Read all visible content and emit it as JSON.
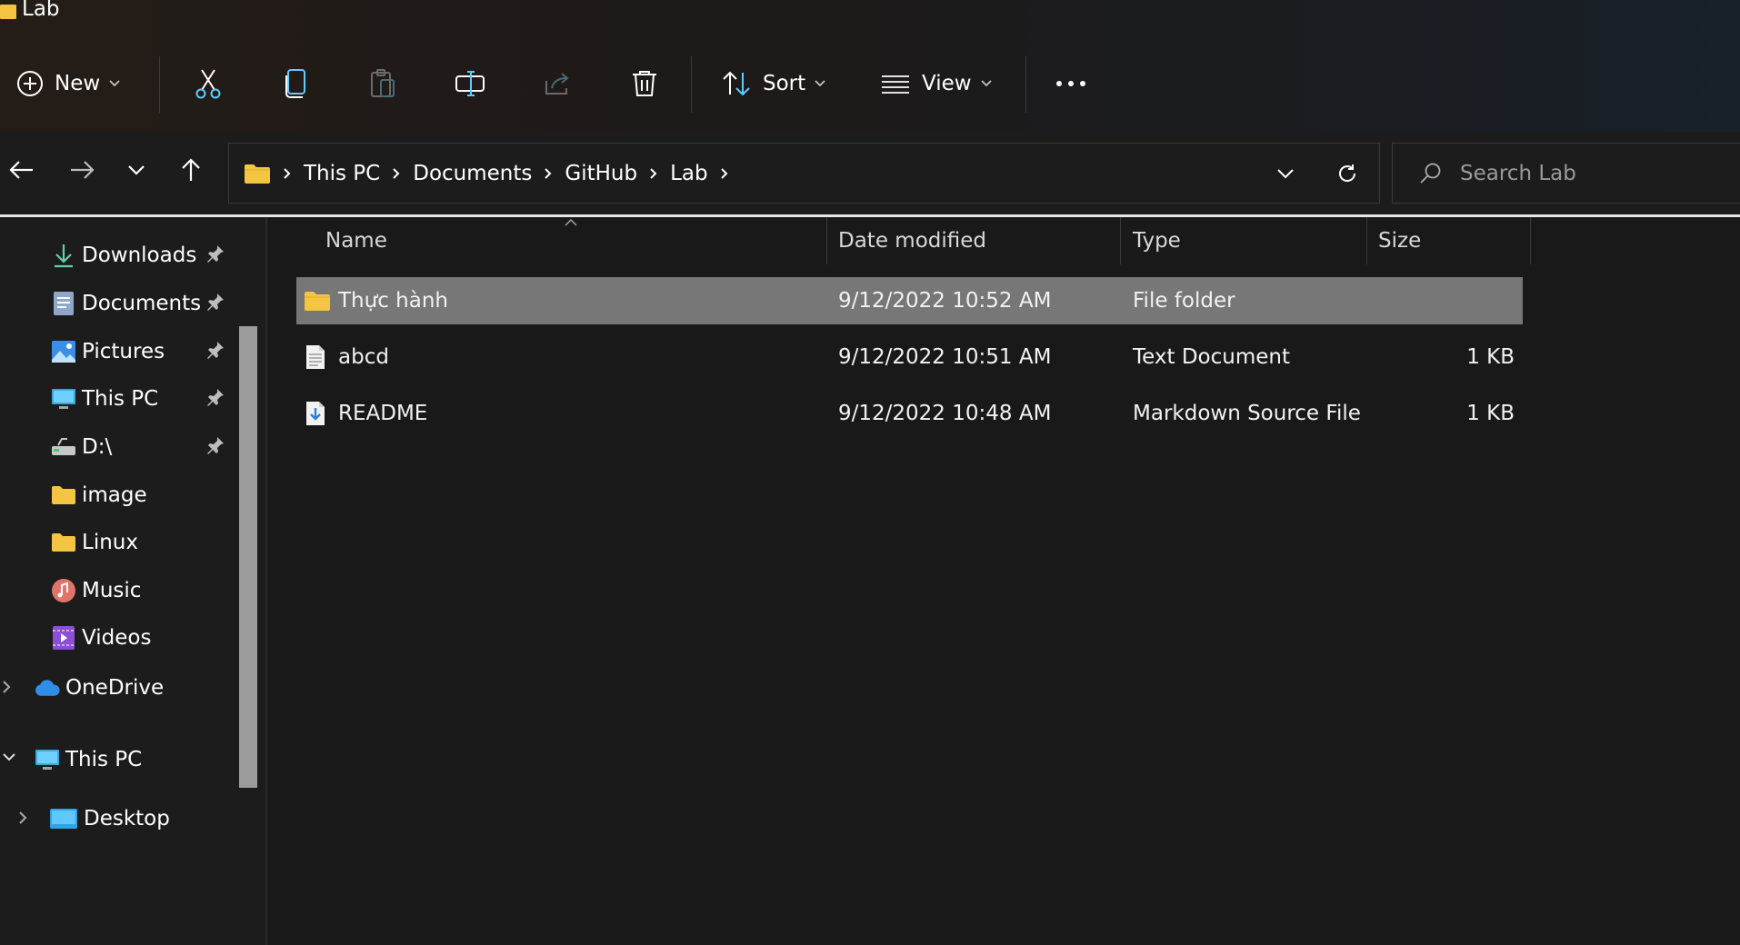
{
  "window": {
    "title": "Lab"
  },
  "toolbar": {
    "new_label": "New",
    "sort_label": "Sort",
    "view_label": "View",
    "icons": [
      "add-circle-icon",
      "cut-icon",
      "copy-icon",
      "paste-icon",
      "rename-icon",
      "share-icon",
      "delete-icon",
      "sort-icon",
      "view-icon",
      "more-icon"
    ]
  },
  "address": {
    "crumbs": [
      "This PC",
      "Documents",
      "GitHub",
      "Lab"
    ]
  },
  "search": {
    "placeholder": "Search Lab"
  },
  "sidebar": {
    "quick_access": [
      {
        "label": "Downloads",
        "icon": "download-icon",
        "pinned": true
      },
      {
        "label": "Documents",
        "icon": "documents-icon",
        "pinned": true
      },
      {
        "label": "Pictures",
        "icon": "pictures-icon",
        "pinned": true
      },
      {
        "label": "This PC",
        "icon": "computer-icon",
        "pinned": true
      },
      {
        "label": "D:\\",
        "icon": "drive-icon",
        "pinned": true
      },
      {
        "label": "image",
        "icon": "folder-icon",
        "pinned": false
      },
      {
        "label": "Linux",
        "icon": "folder-icon",
        "pinned": false
      },
      {
        "label": "Music",
        "icon": "music-icon",
        "pinned": false
      },
      {
        "label": "Videos",
        "icon": "videos-icon",
        "pinned": false
      }
    ],
    "onedrive": {
      "label": "OneDrive",
      "icon": "cloud-icon"
    },
    "this_pc": {
      "label": "This PC",
      "icon": "computer-icon"
    },
    "desktop": {
      "label": "Desktop",
      "icon": "desktop-icon"
    }
  },
  "columns": {
    "name": "Name",
    "date": "Date modified",
    "type": "Type",
    "size": "Size"
  },
  "files": [
    {
      "name": "Thực hành",
      "date": "9/12/2022 10:52 AM",
      "type": "File folder",
      "size": "",
      "icon": "folder-icon",
      "selected": true
    },
    {
      "name": "abcd",
      "date": "9/12/2022 10:51 AM",
      "type": "Text Document",
      "size": "1 KB",
      "icon": "text-file-icon",
      "selected": false
    },
    {
      "name": "README",
      "date": "9/12/2022 10:48 AM",
      "type": "Markdown Source File",
      "size": "1 KB",
      "icon": "markdown-file-icon",
      "selected": false
    }
  ],
  "colors": {
    "folder": "#f4c542",
    "accent": "#60cdff",
    "selected_row": "#777777"
  }
}
